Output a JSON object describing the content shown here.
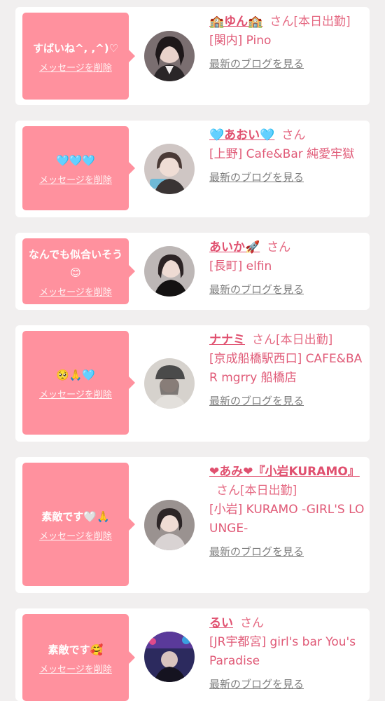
{
  "messages": [
    {
      "message": "すばいね^, ,^)♡",
      "delete_label": "メッセージを削除",
      "name": "🏫ゆん🏫",
      "suffix": "さん[本日出勤]",
      "shop": "[関内] Pino",
      "blog_label": "最新のブログを見る"
    },
    {
      "message": "🩵🩵🩵",
      "delete_label": "メッセージを削除",
      "name": "🩵あおい🩵",
      "suffix": "さん",
      "shop": "[上野] Cafe&Bar 純愛牢獄",
      "blog_label": "最新のブログを見る"
    },
    {
      "message": "なんでも似合いそう😊",
      "delete_label": "メッセージを削除",
      "name": "あいか🚀",
      "suffix": "さん",
      "shop": "[長町] elfin",
      "blog_label": "最新のブログを見る"
    },
    {
      "message": "🥺🙏🩵",
      "delete_label": "メッセージを削除",
      "name": "ナナミ",
      "suffix": "さん[本日出勤]",
      "shop": "[京成船橋駅西口] CAFE&BAR mgrry 船橋店",
      "blog_label": "最新のブログを見る"
    },
    {
      "message": "素敵です🤍🙏",
      "delete_label": "メッセージを削除",
      "name": "❤あみ❤『小岩KURAMO』",
      "suffix": "さん[本日出勤]",
      "shop": "[小岩] KURAMO -GIRL'S LOUNGE-",
      "blog_label": "最新のブログを見る"
    },
    {
      "message": "素敵です🥰",
      "delete_label": "メッセージを削除",
      "name": "るい",
      "suffix": "さん",
      "shop": "[JR宇都宮] girl's bar You's Paradise",
      "blog_label": "最新のブログを見る"
    }
  ],
  "colors": {
    "bubble": "#ff919e",
    "accent_text": "#e0506f",
    "link_gray": "#7d7d7d",
    "page_bg": "#f1efef"
  }
}
